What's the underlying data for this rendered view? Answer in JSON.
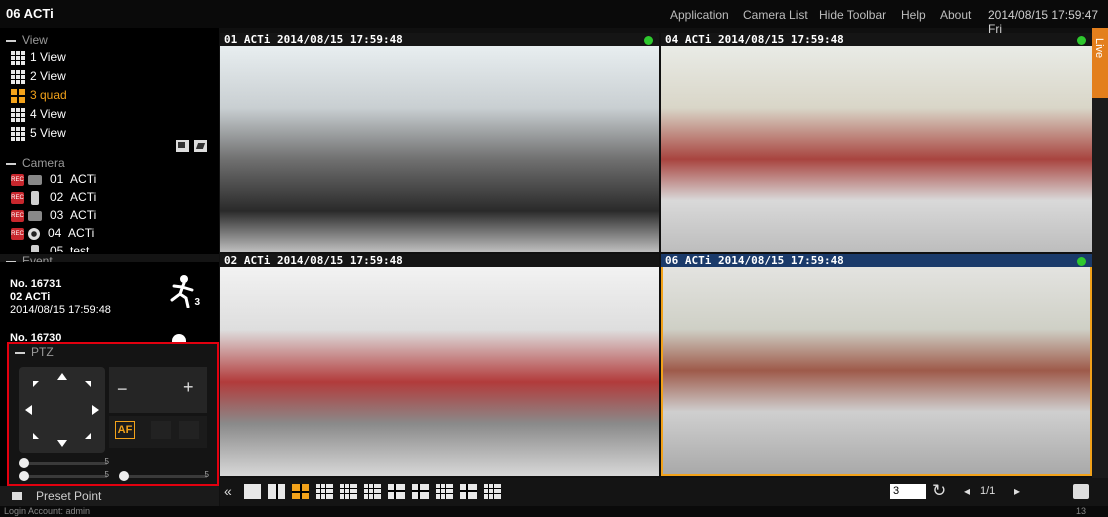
{
  "app": {
    "title": "06 ACTi"
  },
  "menu": {
    "application": "Application",
    "camera_list": "Camera List",
    "hide_toolbar": "Hide Toolbar",
    "help": "Help",
    "about": "About",
    "datetime": "2014/08/15 17:59:47 Fri"
  },
  "sidebar": {
    "view_header": "View",
    "views": [
      {
        "label": "1 View",
        "icon": "grid-icon"
      },
      {
        "label": "2 View",
        "icon": "grid-icon"
      },
      {
        "label": "3 quad",
        "icon": "quad-icon",
        "selected": true
      },
      {
        "label": "4 View",
        "icon": "grid-icon"
      },
      {
        "label": "5 View",
        "icon": "grid-icon"
      }
    ],
    "camera_header": "Camera",
    "cameras": [
      {
        "id": "01",
        "name": "ACTi"
      },
      {
        "id": "02",
        "name": "ACTi"
      },
      {
        "id": "03",
        "name": "ACTi"
      },
      {
        "id": "04",
        "name": "ACTi"
      },
      {
        "id": "05",
        "name": "test"
      }
    ],
    "event_header": "Event",
    "events": [
      {
        "no": "No. 16731",
        "camera": "02 ACTi",
        "time": "2014/08/15 17:59:48",
        "badge": "3"
      },
      {
        "no": "No. 16730"
      }
    ],
    "ptz_header": "PTZ",
    "ptz": {
      "zoom_out": "−",
      "zoom_in": "+",
      "slider_scale": "5",
      "af_label": "AF"
    },
    "preset_header": "Preset Point",
    "login": "Login Account: admin"
  },
  "cameras": [
    {
      "title": "01 ACTi  2014/08/15 17:59:48"
    },
    {
      "title": "04 ACTi  2014/08/15 17:59:48"
    },
    {
      "title": "02 ACTi  2014/08/15 17:59:48"
    },
    {
      "title": "06 ACTi  2014/08/15 17:59:48"
    }
  ],
  "right_tabs": {
    "live": "Live"
  },
  "toolbar": {
    "collapse": "«",
    "page_input": "3",
    "page_of": "1/1",
    "prev": "◂",
    "next": "▸",
    "status_count": "13"
  },
  "colors": {
    "accent": "#f2a21a",
    "rec": "#c8272d",
    "highlight": "#e3000f",
    "online": "#2ec82e"
  }
}
